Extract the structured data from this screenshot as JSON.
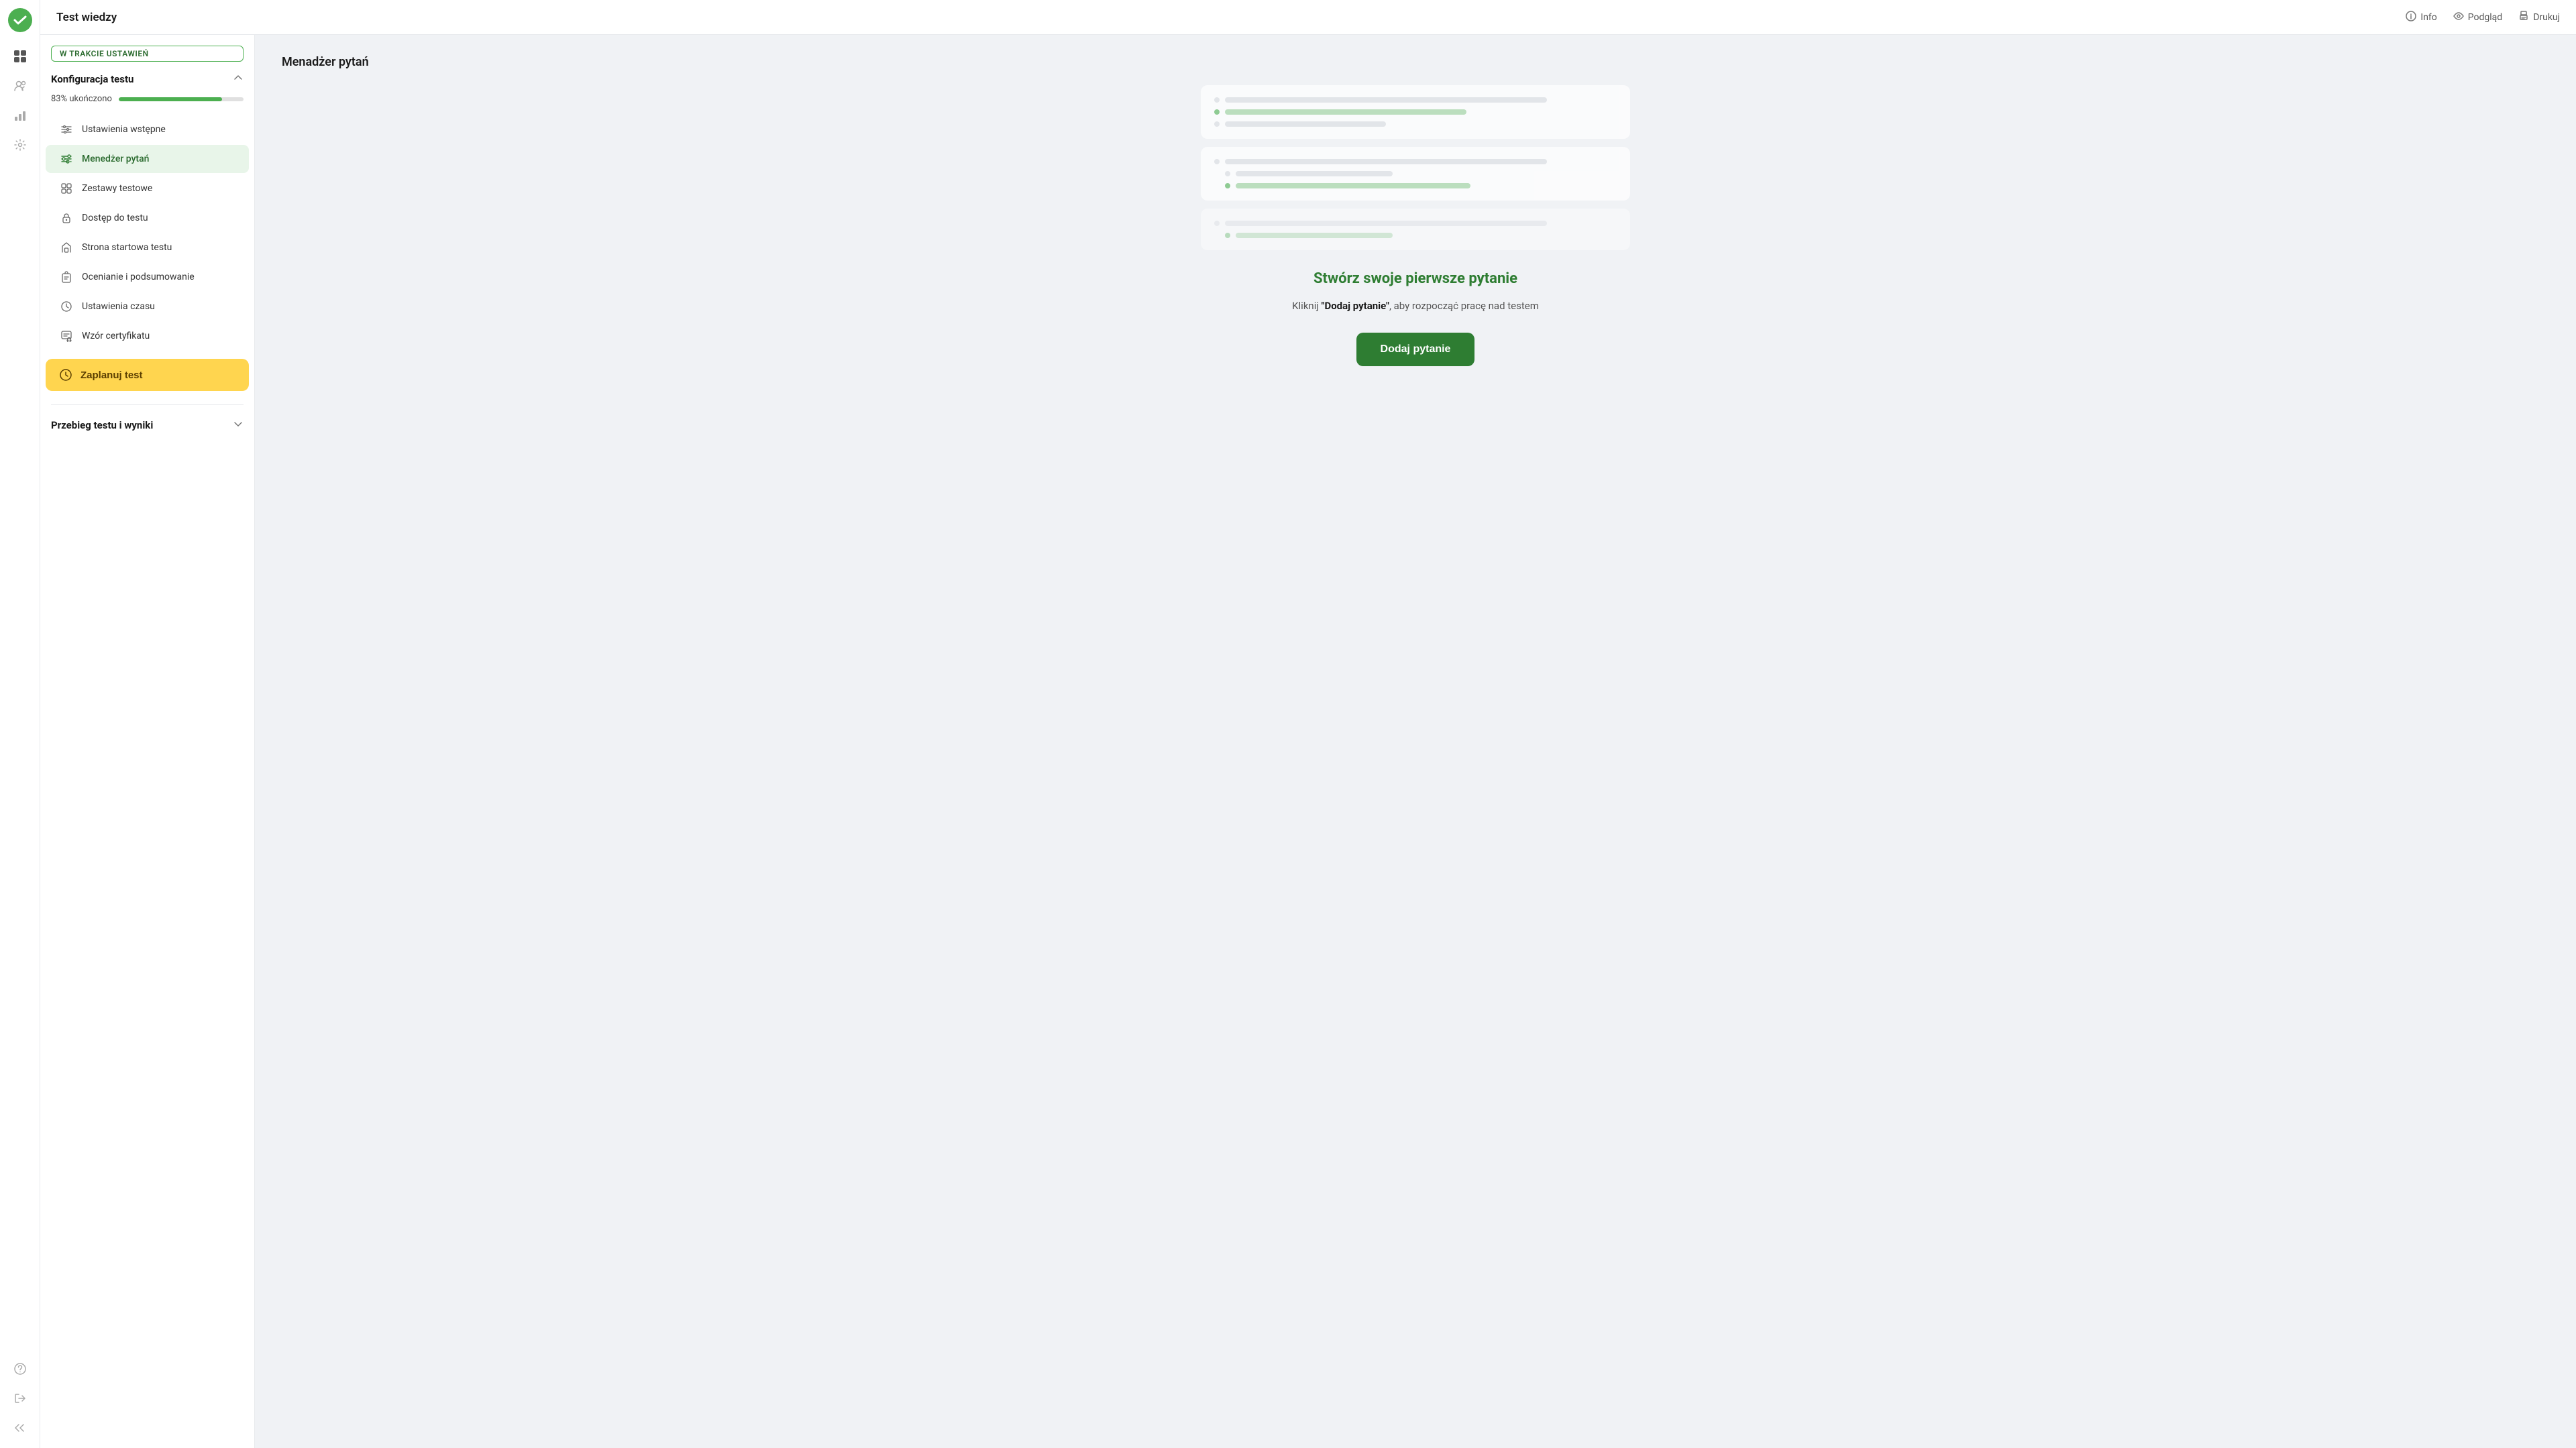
{
  "app": {
    "title": "Test wiedzy"
  },
  "header": {
    "title": "Test wiedzy",
    "actions": [
      {
        "id": "info",
        "label": "Info",
        "icon": "info-circle"
      },
      {
        "id": "podglad",
        "label": "Podgląd",
        "icon": "eye"
      },
      {
        "id": "drukuj",
        "label": "Drukuj",
        "icon": "printer"
      }
    ]
  },
  "left_panel": {
    "status_badge": "W TRAKCIE USTAWIEŃ",
    "config_section": {
      "title": "Konfiguracja testu",
      "progress_label": "83% ukończono",
      "progress_value": 83,
      "menu_items": [
        {
          "id": "ustawienia-wstepne",
          "label": "Ustawienia wstępne",
          "icon": "sliders",
          "active": false
        },
        {
          "id": "menedzer-pytan",
          "label": "Menedżer pytań",
          "icon": "adjustments",
          "active": true
        },
        {
          "id": "zestawy-testowe",
          "label": "Zestawy testowe",
          "icon": "grid",
          "active": false
        },
        {
          "id": "dostep-do-testu",
          "label": "Dostęp do testu",
          "icon": "lock",
          "active": false
        },
        {
          "id": "strona-startowa",
          "label": "Strona startowa testu",
          "icon": "file-home",
          "active": false
        },
        {
          "id": "ocenianie",
          "label": "Ocenianie i podsumowanie",
          "icon": "clipboard",
          "active": false
        },
        {
          "id": "ustawienia-czasu",
          "label": "Ustawienia czasu",
          "icon": "clock",
          "active": false
        },
        {
          "id": "wzor-certyfikatu",
          "label": "Wzór certyfikatu",
          "icon": "certificate",
          "active": false
        }
      ],
      "schedule_button": "Zaplanuj test"
    },
    "results_section": {
      "title": "Przebieg testu i wyniki"
    }
  },
  "main_content": {
    "section_title": "Menadżer pytań",
    "cta": {
      "title": "Stwórz swoje pierwsze pytanie",
      "description_prefix": "Kliknij ",
      "description_bold": "\"Dodaj pytanie\"",
      "description_suffix": ", aby rozpocząć pracę nad testem",
      "button_label": "Dodaj pytanie"
    }
  },
  "sidebar_icons": {
    "logo": "✓",
    "nav": [
      "apps",
      "users",
      "chart",
      "settings"
    ],
    "bottom": [
      "help",
      "exit"
    ]
  }
}
